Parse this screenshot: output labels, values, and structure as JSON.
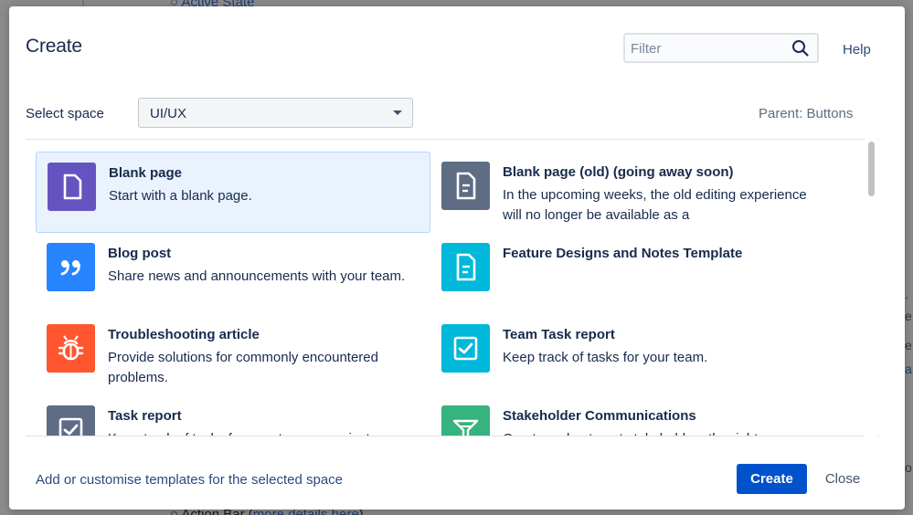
{
  "backdrop": {
    "top_text": "Active State",
    "bottom_text": "Action Bar (",
    "bottom_link": "more details here",
    "bottom_close": ")",
    "right_glyphs": [
      ".",
      "e",
      "e",
      "a",
      "o."
    ]
  },
  "dialog": {
    "title": "Create",
    "filter_placeholder": "Filter",
    "help_label": "Help",
    "space_label": "Select space",
    "space_value": "UI/UX",
    "parent_text": "Parent: Buttons"
  },
  "templates": [
    {
      "title": "Blank page",
      "desc": "Start with a blank page.",
      "icon": "blank-page-icon",
      "color": "#6554c0",
      "selected": true
    },
    {
      "title": "Blank page (old) (going away soon)",
      "desc": "In the upcoming weeks, the old editing experience will no longer be available as a",
      "icon": "document-lines-icon",
      "color": "#5e6c84",
      "selected": false
    },
    {
      "title": "Blog post",
      "desc": "Share news and announcements with your team.",
      "icon": "quote-icon",
      "color": "#2684ff",
      "selected": false
    },
    {
      "title": "Feature Designs and Notes Template",
      "desc": "",
      "icon": "document-lines-icon",
      "color": "#00b8d9",
      "selected": false
    },
    {
      "title": "Troubleshooting article",
      "desc": "Provide solutions for commonly encountered problems.",
      "icon": "bug-icon",
      "color": "#ff5630",
      "selected": false
    },
    {
      "title": "Team Task report",
      "desc": "Keep track of tasks for your team.",
      "icon": "checkbox-icon",
      "color": "#00b8d9",
      "selected": false
    },
    {
      "title": "Task report",
      "desc": "Keep track of tasks for your team or project.",
      "icon": "checkbox-icon",
      "color": "#5e6c84",
      "selected": false
    },
    {
      "title": "Stakeholder Communications",
      "desc": "Create a plan to get stakeholders the right",
      "icon": "megaphone-icon",
      "color": "#36b37e",
      "selected": false
    }
  ],
  "footer": {
    "templates_link": "Add or customise templates for the selected space",
    "create_label": "Create",
    "close_label": "Close"
  }
}
